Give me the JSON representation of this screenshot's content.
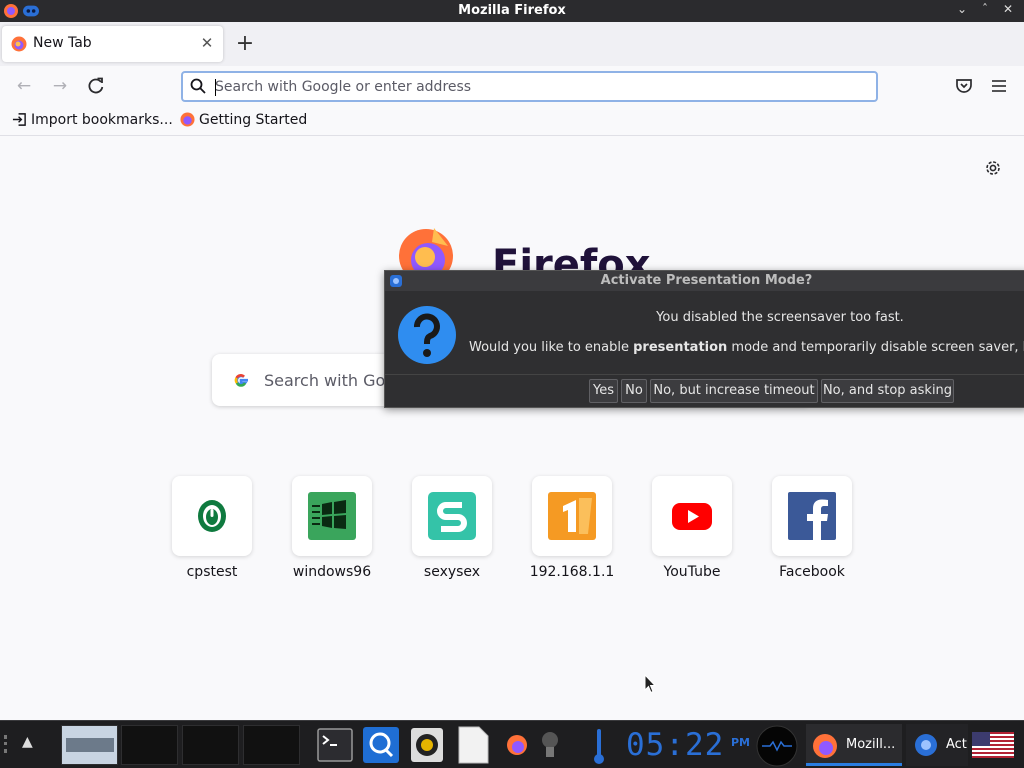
{
  "window": {
    "title": "Mozilla Firefox"
  },
  "tabs": [
    {
      "label": "New Tab"
    }
  ],
  "toolbar": {
    "url_placeholder": "Search with Google or enter address"
  },
  "bookmarks": [
    {
      "label": "Import bookmarks...",
      "icon": "import-icon"
    },
    {
      "label": "Getting Started",
      "icon": "firefox-icon"
    }
  ],
  "newtab": {
    "brand": "Firefox",
    "search_placeholder": "Search with Google or enter address",
    "shortcuts": [
      {
        "label": "cpstest",
        "icon": "mouse-icon"
      },
      {
        "label": "windows96",
        "icon": "windows-icon"
      },
      {
        "label": "sexysex",
        "icon": "s-letter-icon"
      },
      {
        "label": "192.168.1.1",
        "icon": "number-one-icon"
      },
      {
        "label": "YouTube",
        "icon": "youtube-icon"
      },
      {
        "label": "Facebook",
        "icon": "facebook-icon"
      }
    ]
  },
  "dialog": {
    "title": "Activate Presentation Mode?",
    "line1": "You disabled the screensaver too fast.",
    "line2_before": "Would you like to enable ",
    "line2_bold": "presentation",
    "line2_after": " mode and temporarily disable screen saver, lock",
    "buttons": [
      "Yes",
      "No",
      "No, but increase timeout",
      "No, and stop asking"
    ]
  },
  "taskbar": {
    "clock_time": "05:22",
    "clock_ampm": "PM",
    "tasks": [
      {
        "label": "Mozill..."
      },
      {
        "label": "Act"
      }
    ]
  },
  "colors": {
    "accent": "#0060df",
    "dialog_bg": "#2f2f31",
    "clock": "#2a6fd6"
  }
}
